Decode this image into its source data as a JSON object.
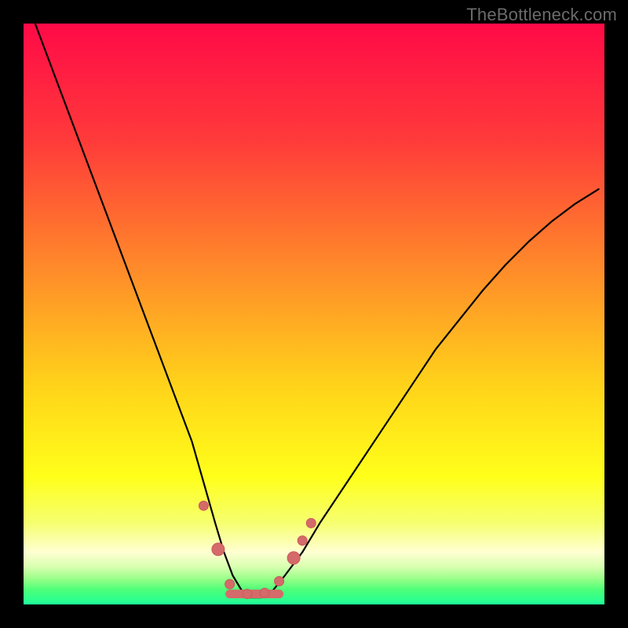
{
  "watermark": {
    "text": "TheBottleneck.com"
  },
  "chart_data": {
    "type": "line",
    "title": "",
    "xlabel": "",
    "ylabel": "",
    "xlim": [
      0,
      100
    ],
    "ylim": [
      0,
      100
    ],
    "grid": false,
    "legend": "none",
    "annotations": [],
    "background_gradient": {
      "orientation": "vertical",
      "stops": [
        {
          "pos": 0.0,
          "color": "#ff0a47"
        },
        {
          "pos": 0.2,
          "color": "#ff3a3a"
        },
        {
          "pos": 0.42,
          "color": "#ff8a2a"
        },
        {
          "pos": 0.62,
          "color": "#ffd21a"
        },
        {
          "pos": 0.78,
          "color": "#ffff1a"
        },
        {
          "pos": 0.86,
          "color": "#f6ff70"
        },
        {
          "pos": 0.91,
          "color": "#ffffd2"
        },
        {
          "pos": 0.935,
          "color": "#d9ffb0"
        },
        {
          "pos": 0.955,
          "color": "#9cff8a"
        },
        {
          "pos": 0.975,
          "color": "#4cff78"
        },
        {
          "pos": 1.0,
          "color": "#1eff9a"
        }
      ]
    },
    "series": [
      {
        "name": "bottleneck-curve",
        "color": "#000000",
        "width": 2.2,
        "x": [
          2,
          5,
          8,
          11,
          14,
          17,
          20,
          23,
          26,
          29,
          31,
          33,
          34.5,
          36,
          37.5,
          39,
          41,
          43,
          45,
          48,
          51,
          55,
          59,
          63,
          67,
          71,
          75,
          79,
          83,
          87,
          91,
          95,
          99
        ],
        "y": [
          100,
          92,
          84,
          76,
          68,
          60,
          52,
          44,
          36,
          28,
          21,
          14,
          9,
          5,
          2.5,
          1.2,
          1.2,
          2.5,
          5,
          9,
          14,
          20,
          26,
          32,
          38,
          44,
          49,
          54,
          58.5,
          62.5,
          66,
          69,
          71.5
        ]
      }
    ],
    "markers": {
      "name": "highlight-points",
      "color": "#d46a6a",
      "stroke": "#c95a5a",
      "radius_small": 6,
      "radius_large": 8,
      "stem_width": 11,
      "points": [
        {
          "x": 31.0,
          "y": 17.0,
          "r": "small"
        },
        {
          "x": 33.5,
          "y": 9.5,
          "r": "large"
        },
        {
          "x": 35.5,
          "y": 3.5,
          "r": "small"
        },
        {
          "x": 38.5,
          "y": 1.8,
          "r": "small"
        },
        {
          "x": 41.5,
          "y": 2.0,
          "r": "small"
        },
        {
          "x": 44.0,
          "y": 4.0,
          "r": "small"
        },
        {
          "x": 46.5,
          "y": 8.0,
          "r": "large"
        },
        {
          "x": 48.0,
          "y": 11.0,
          "r": "small"
        },
        {
          "x": 49.5,
          "y": 14.0,
          "r": "small"
        }
      ],
      "stem": {
        "x1": 35.5,
        "x2": 44.0,
        "y": 1.8
      }
    }
  }
}
